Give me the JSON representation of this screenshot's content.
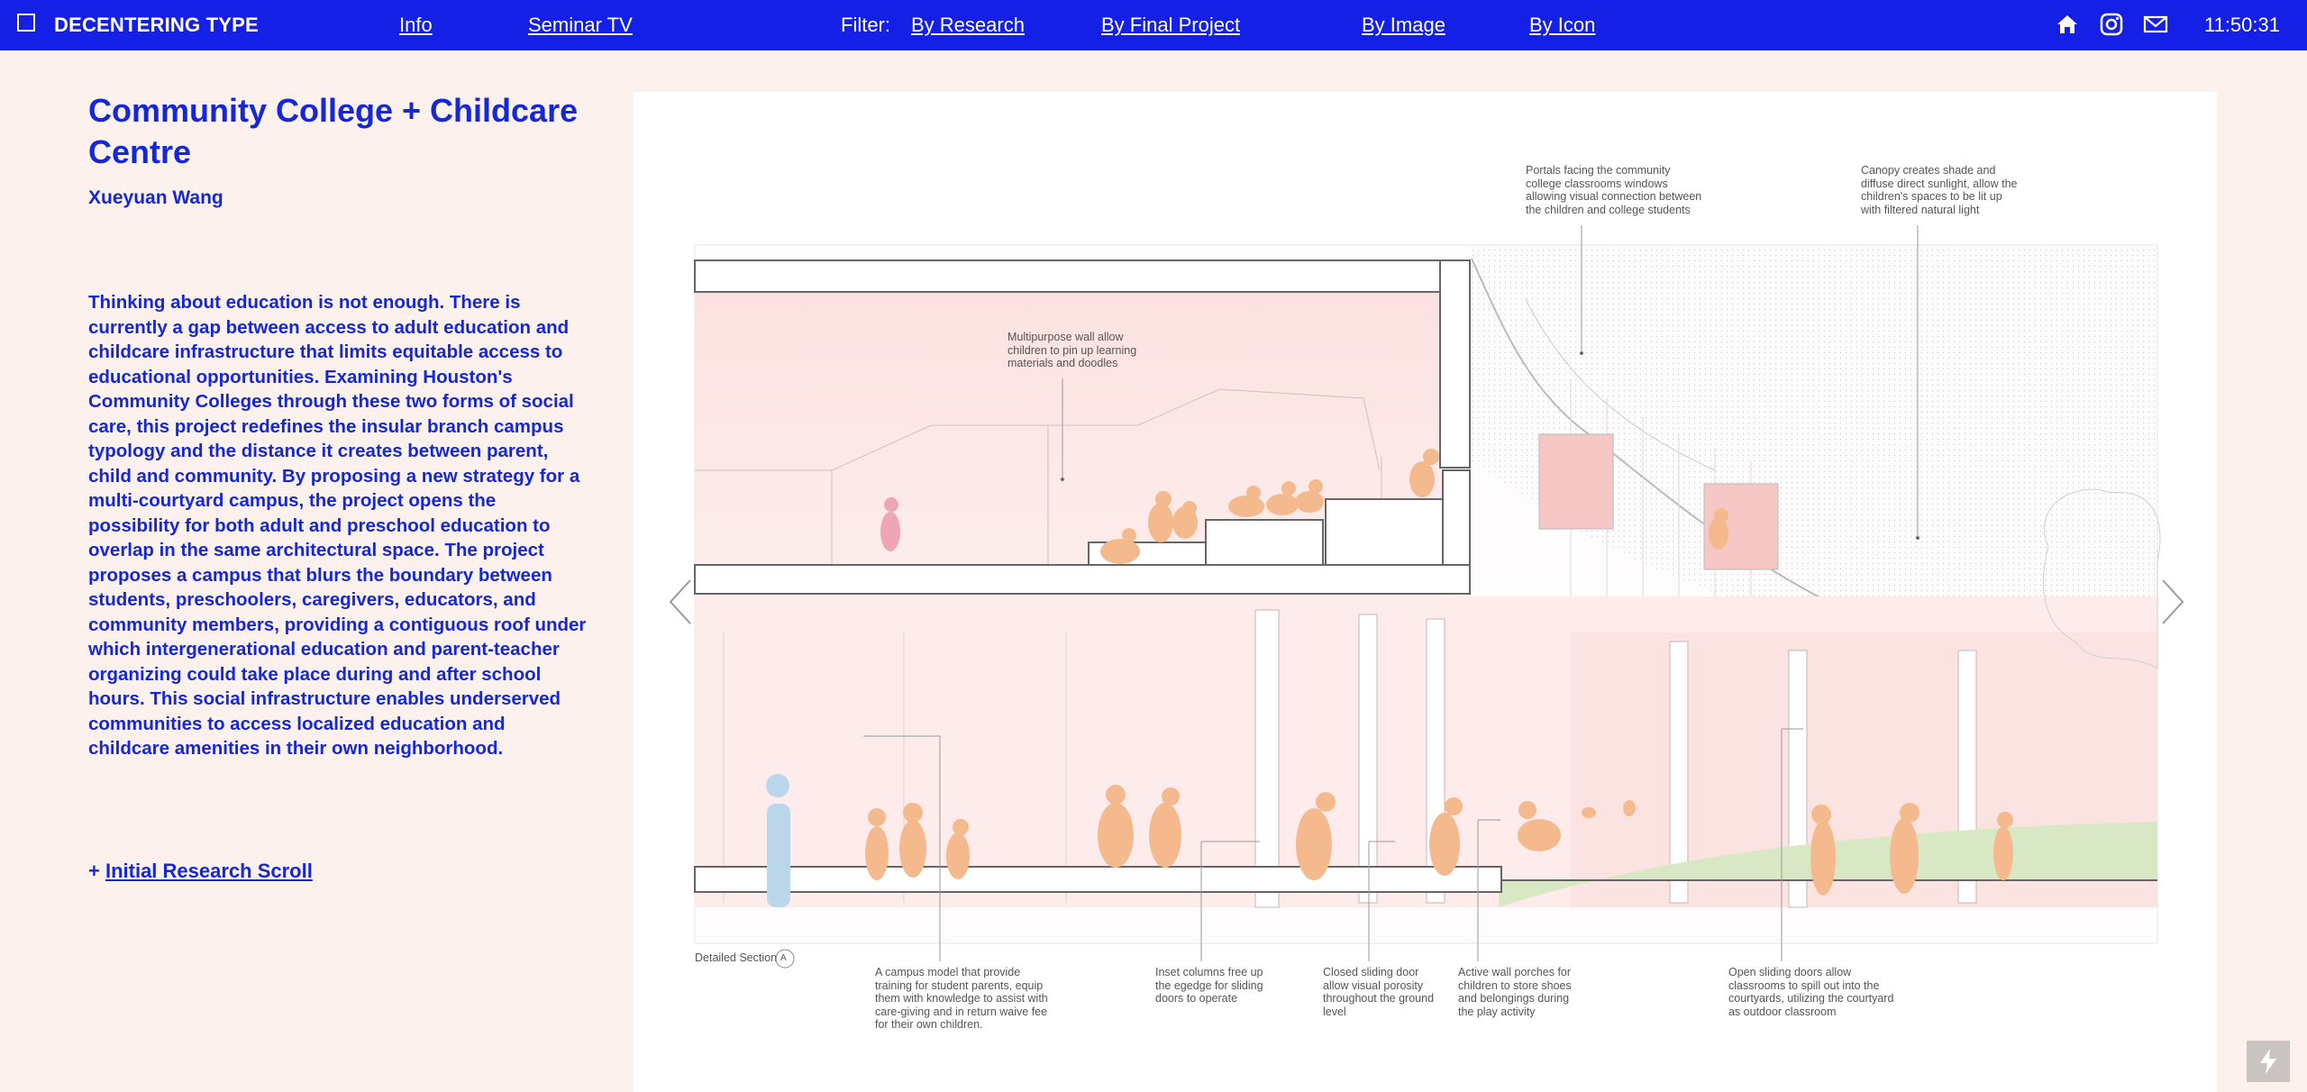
{
  "topbar": {
    "brand": "DECENTERING TYPE",
    "nav": [
      "Info",
      "Seminar TV"
    ],
    "filter_label": "Filter:",
    "filters": [
      "By Research",
      "By Final Project",
      "By Image",
      "By Icon"
    ],
    "icons": [
      "home-icon",
      "instagram-icon",
      "mail-icon"
    ],
    "clock": "11:50:31",
    "colors": {
      "bar": "#1420e6",
      "text": "#ffffff"
    }
  },
  "project": {
    "title": "Community College + Childcare Centre",
    "author": "Xueyuan Wang",
    "description": "Thinking about education is not enough. There is currently a gap between access to adult education and childcare infrastructure that limits equitable access to educational opportunities. Examining Houston's Community Colleges through these two forms of social care, this project redefines the insular branch campus typology and the distance it creates between parent, child and community.  By proposing a new strategy for a multi-courtyard campus, the project opens the possibility for both adult and preschool education to overlap in the same architectural space. The project proposes a campus that blurs the boundary between students, preschoolers, caregivers, educators, and community members, providing a contiguous roof under which intergenerational education and parent-teacher organizing could take place during and after school hours. This social infrastructure enables underserved communities to access localized education and childcare amenities in their own neighborhood.",
    "research_prefix": "+ ",
    "research_link": "Initial Research Scroll",
    "colors": {
      "text": "#1428d8",
      "background": "#fcf1ec"
    }
  },
  "drawing": {
    "section_label": "Detailed Section",
    "section_marker": "A",
    "annotations": {
      "portals": "Portals facing the community college classrooms windows allowing visual connection between the children and college students",
      "canopy": "Canopy creates shade and diffuse direct sunlight, allow the children's spaces to be lit up with filtered natural light",
      "multipurpose": "Multipurpose wall allow children to pin up learning materials and doodles",
      "campus_model": "A campus model that provide training for student parents, equip them with knowledge to assist with care-giving and in return waive fee for their own children.",
      "inset_columns": "Inset columns free up the egedge for sliding doors to operate",
      "closed_doors": "Closed sliding door allow visual porosity throughout the ground level",
      "wall_porches": "Active wall porches for children to store shoes and belongings during the play activity",
      "open_doors": "Open sliding doors allow classrooms to spill out into the courtyards, utilizing the courtyard as outdoor classroom"
    },
    "colors": {
      "figures": "#f5b98e",
      "adult": "#b9d6ea",
      "interior": "#fbe3e1",
      "grass": "#d9e8c4"
    }
  },
  "carousel": {
    "prev": "chevron-left-icon",
    "next": "chevron-right-icon"
  },
  "corner_button": "lightning-icon"
}
